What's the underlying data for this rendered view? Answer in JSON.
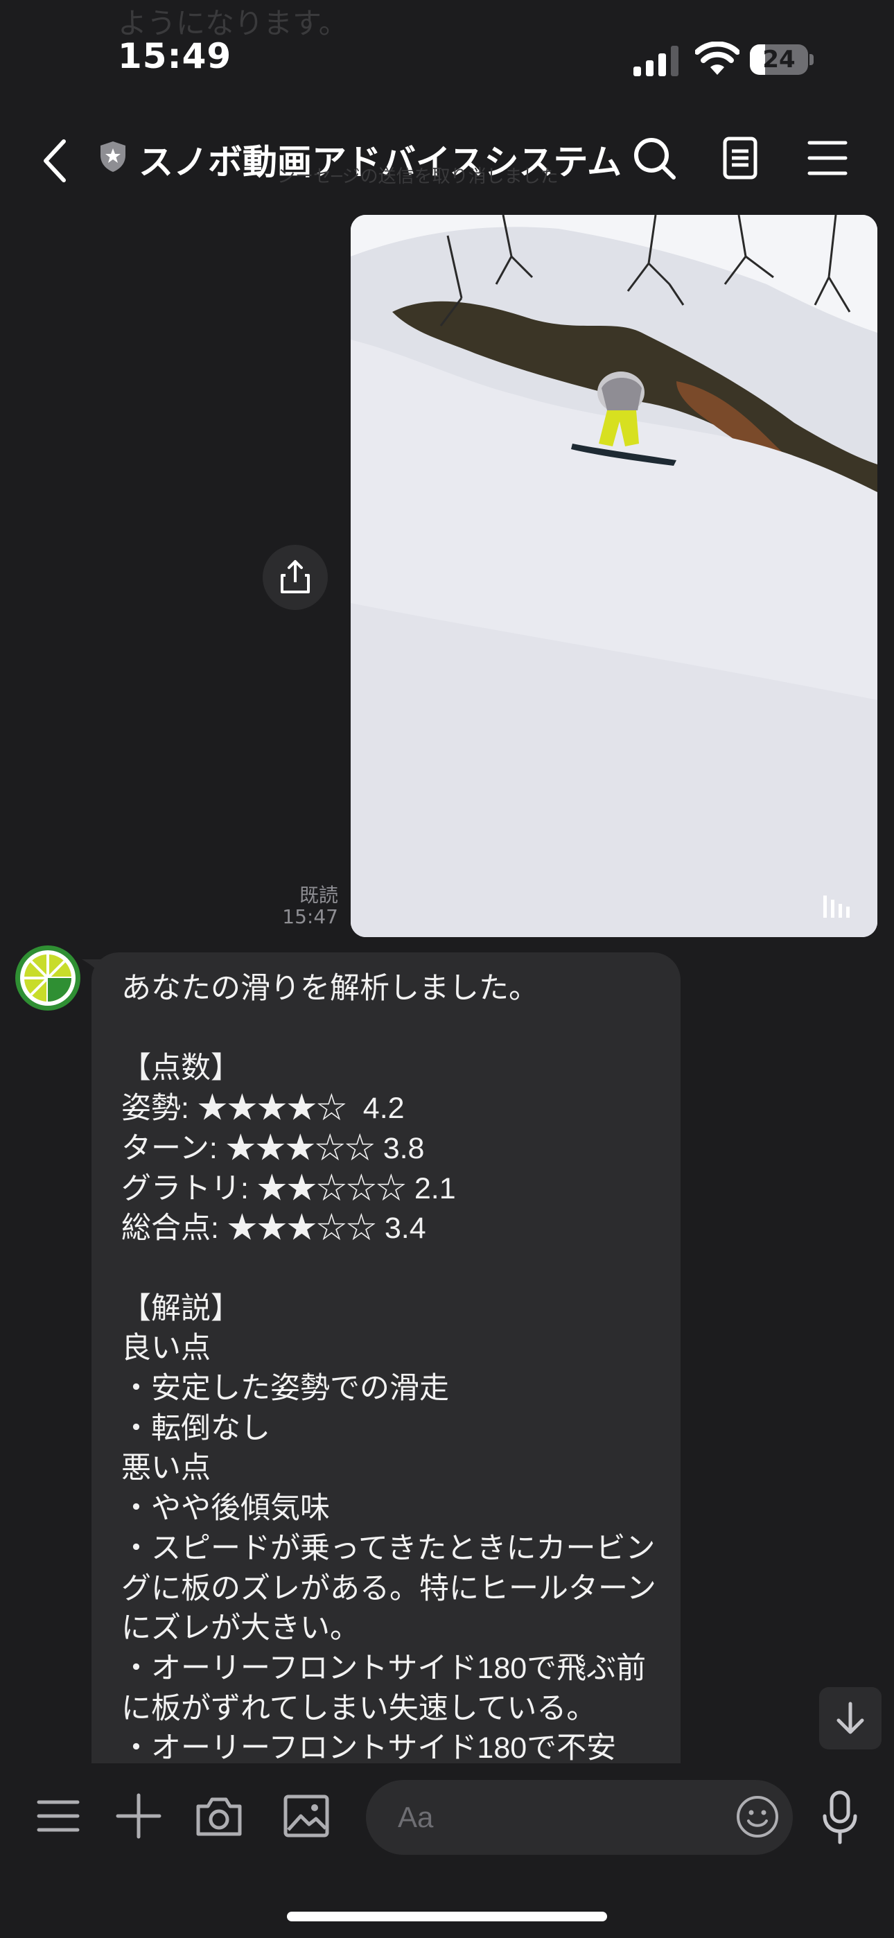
{
  "status_bar": {
    "time": "15:49",
    "battery": "24",
    "behind_text": "ようになります。"
  },
  "header": {
    "title": "スノボ動画アドバイスシステム",
    "behind_text": "ンーセ─ジの送信を取り消しました"
  },
  "image_message": {
    "read_label": "既読",
    "time": "15:47"
  },
  "bot_message": {
    "text": "あなたの滑りを解析しました。\n\n【点数】\n姿勢: ★★★★☆  4.2\nターン: ★★★☆☆ 3.8\nグラトリ: ★★☆☆☆ 2.1\n総合点: ★★★☆☆ 3.4\n\n【解説】\n良い点\n・安定した姿勢での滑走\n・転倒なし\n悪い点\n・やや後傾気味\n・スピードが乗ってきたときにカービングに板のズレがある。特にヒールターンにズレが大きい。\n・オーリーフロントサイド180で飛ぶ前に板がずれてしまい失速している。\n・オーリーフロントサイド180で不安"
  },
  "input": {
    "placeholder": "Aa"
  },
  "colors": {
    "background": "#1c1c1e",
    "bubble": "#2c2c2e",
    "avatar_green": "#2f8f33",
    "lime": "#c8dc2a"
  },
  "icons": [
    "back-icon",
    "shield-icon",
    "search-icon",
    "notes-icon",
    "menu-icon",
    "share-icon",
    "media-bars-icon",
    "scroll-down-icon",
    "list-icon",
    "plus-icon",
    "camera-icon",
    "image-icon",
    "emoji-icon",
    "mic-icon"
  ]
}
